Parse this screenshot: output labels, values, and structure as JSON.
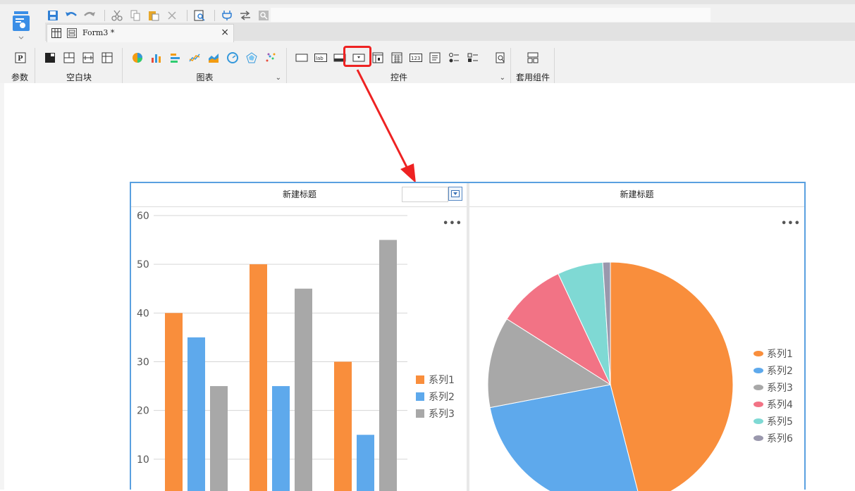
{
  "tab": {
    "label": "Form3 *",
    "close": "×"
  },
  "ribbon": {
    "groups": [
      {
        "label": "参数"
      },
      {
        "label": "空白块"
      },
      {
        "label": "图表"
      },
      {
        "label": "控件"
      },
      {
        "label": "套用组件"
      }
    ]
  },
  "form": {
    "left_title": "新建标题",
    "right_title": "新建标题",
    "more": "•••"
  },
  "colors": {
    "accent": "#5aa0e0",
    "highlight": "#ee2222",
    "s1": "#f98e3c",
    "s2": "#5ea9ec",
    "s3": "#a8a8a8",
    "s4": "#f27385",
    "s5": "#7fd9d4",
    "s6": "#9a98ad"
  },
  "chart_data": [
    {
      "type": "bar",
      "categories": [
        "",
        "",
        ""
      ],
      "series": [
        {
          "name": "系列1",
          "values": [
            40,
            50,
            30
          ]
        },
        {
          "name": "系列2",
          "values": [
            35,
            25,
            15
          ]
        },
        {
          "name": "系列3",
          "values": [
            25,
            45,
            55
          ]
        }
      ],
      "yticks": [
        10,
        20,
        30,
        40,
        50,
        60
      ],
      "ylim": [
        0,
        60
      ],
      "legend": "right",
      "grid": true
    },
    {
      "type": "pie",
      "series": [
        {
          "name": "系列1",
          "value": 46
        },
        {
          "name": "系列2",
          "value": 26
        },
        {
          "name": "系列3",
          "value": 12
        },
        {
          "name": "系列4",
          "value": 9
        },
        {
          "name": "系列5",
          "value": 6
        },
        {
          "name": "系列6",
          "value": 1
        }
      ],
      "legend": "right"
    }
  ]
}
